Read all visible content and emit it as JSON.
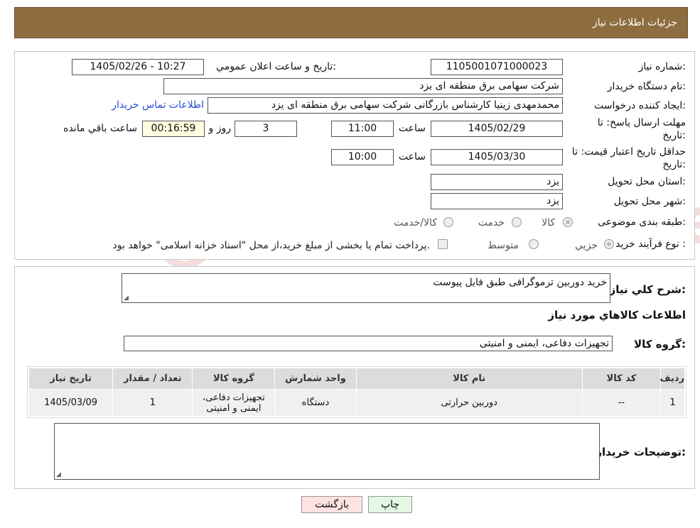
{
  "header": {
    "title": "جزئیات اطلاعات نیاز"
  },
  "form": {
    "need_number_label": "شماره نیاز:",
    "need_number": "1105001071000023",
    "announce_label": "تاریخ و ساعت اعلان عمومي:",
    "announce_value": "1405/02/26 - 10:27",
    "buyer_org_label": "نام دستگاه خريدار:",
    "buyer_org": "شرکت سهامی برق منطقه ای یزد",
    "creator_label": "ايجاد كننده درخواست:",
    "creator": "محمدمهدی زینیا کارشناس بازرگانی شرکت سهامی برق منطقه ای یزد",
    "contact_link": "اطلاعات تماس خريدار",
    "deadline_label_1": "مهلت ارسال پاسخ: تا",
    "deadline_label_2": "تاریخ:",
    "deadline_date": "1405/02/29",
    "time_label": "ساعت",
    "deadline_time": "11:00",
    "days_value": "3",
    "days_label": "روز و",
    "remaining_time": "00:16:59",
    "remaining_label": "ساعت باقي مانده",
    "validity_label_1": "حداقل تاريخ اعتبار قيمت: تا",
    "validity_label_2": "تاريخ:",
    "validity_date": "1405/03/30",
    "validity_time": "10:00",
    "province_label": "استان محل تحويل:",
    "province": "یزد",
    "city_label": "شهر محل تحويل:",
    "city": "یزد",
    "category_label": "طبقه بندی موضوعی:",
    "category_options": [
      "کالا",
      "خدمت",
      "کالا/خدمت"
    ],
    "process_label": "نوع فرآيند خريد :",
    "process_options": [
      "جزيي",
      "متوسط"
    ],
    "process_note": "پرداخت تمام يا بخشی از مبلغ خريد،از محل \"اسناد خزانه اسلامی\" خواهد بود."
  },
  "details": {
    "summary_label": "شرح کلي نياز:",
    "summary_value": "خرید دوربین ترموگرافی طبق فایل پیوست",
    "goods_title": "اطلاعات کالاهاي مورد نياز",
    "group_label": "گروه کالا:",
    "group_value": "تجهیزات دفاعی، ایمنی و امنیتی",
    "table": {
      "headers": [
        "رديف",
        "کد کالا",
        "نام کالا",
        "واحد شمارش",
        "گروه کالا",
        "تعداد / مقدار",
        "تاريخ نياز"
      ],
      "rows": [
        [
          "1",
          "--",
          "دوربين حرارتی",
          "دستگاه",
          "تجهیزات دفاعی، ایمنی و امنیتی",
          "1",
          "1405/03/09"
        ]
      ]
    },
    "buyer_notes_label": "توضيحات خريدار:"
  },
  "buttons": {
    "print": "چاپ",
    "back": "بازگشت"
  },
  "watermark": {
    "text": "AriaTender.neT"
  },
  "colors": {
    "header_bg": "#8d6d3f",
    "link": "#2a4fd6",
    "remaining_bg": "#ffffe0",
    "back_btn_bg": "#fde2e2",
    "print_btn_bg": "#e4f7e4"
  }
}
